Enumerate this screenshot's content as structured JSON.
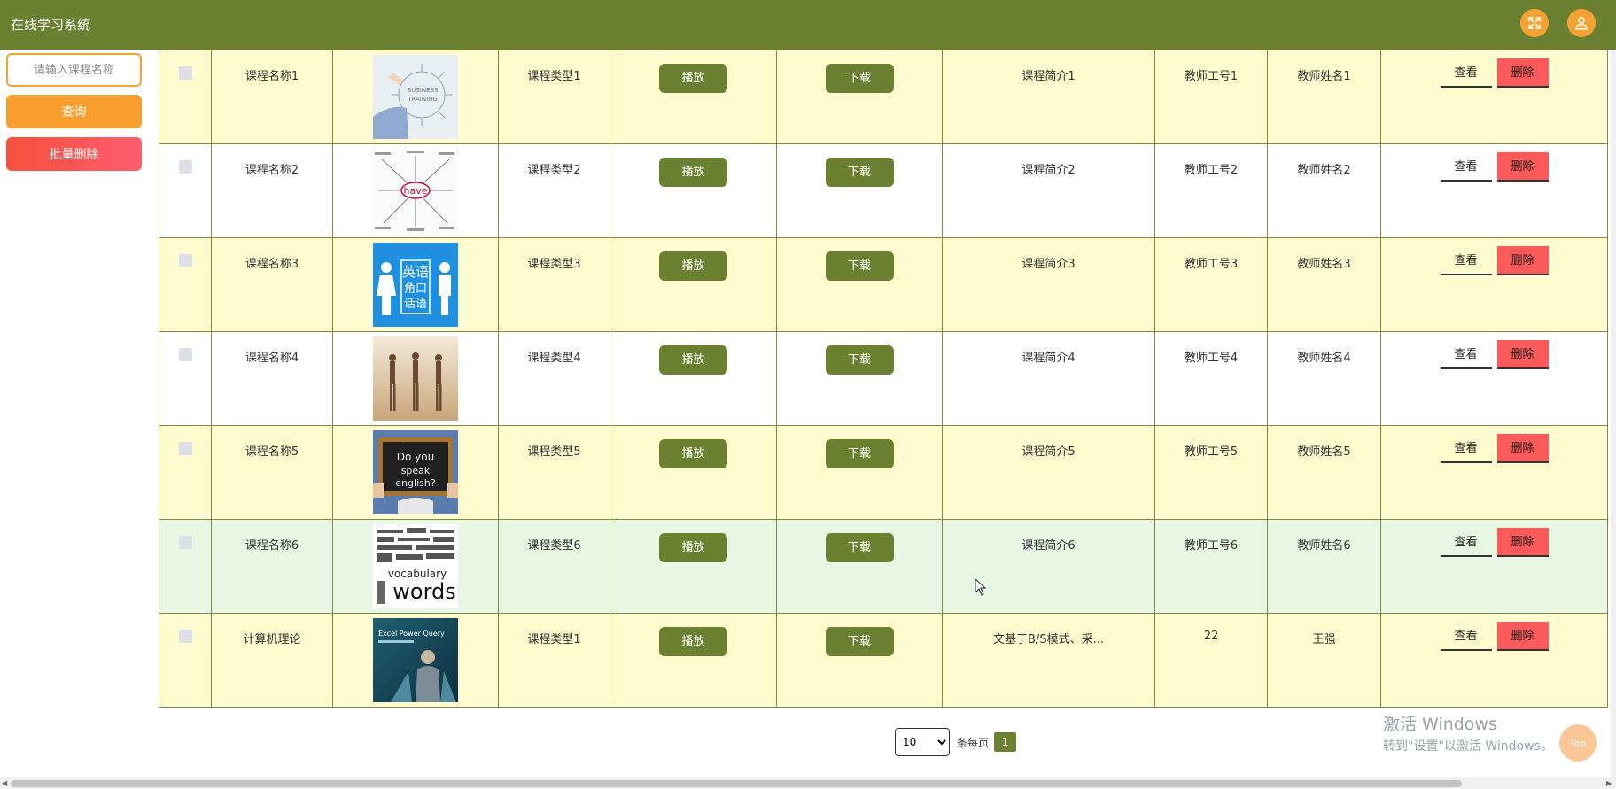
{
  "header": {
    "app_title": "在线学习系统",
    "fullscreen_icon": "fullscreen-icon",
    "user_icon": "user-icon",
    "accent_color": "#6b8030"
  },
  "sidebar": {
    "search_placeholder": "请输入课程名称",
    "query_label": "查询",
    "batch_delete_label": "批量删除"
  },
  "table": {
    "play_label": "播放",
    "download_label": "下载",
    "view_label": "查看",
    "delete_label": "删除",
    "rows": [
      {
        "name": "课程名称1",
        "image": "business-training",
        "type": "课程类型1",
        "intro": "课程简介1",
        "teacher_id": "教师工号1",
        "teacher_name": "教师姓名1"
      },
      {
        "name": "课程名称2",
        "image": "have-word-map",
        "type": "课程类型2",
        "intro": "课程简介2",
        "teacher_id": "教师工号2",
        "teacher_name": "教师姓名2"
      },
      {
        "name": "课程名称3",
        "image": "english-corner-sign",
        "type": "课程类型3",
        "intro": "课程简介3",
        "teacher_id": "教师工号3",
        "teacher_name": "教师姓名3"
      },
      {
        "name": "课程名称4",
        "image": "dancers",
        "type": "课程类型4",
        "intro": "课程简介4",
        "teacher_id": "教师工号4",
        "teacher_name": "教师姓名4"
      },
      {
        "name": "课程名称5",
        "image": "do-you-speak-english",
        "type": "课程类型5",
        "intro": "课程简介5",
        "teacher_id": "教师工号5",
        "teacher_name": "教师姓名5"
      },
      {
        "name": "课程名称6",
        "image": "vocabulary-words",
        "type": "课程类型6",
        "intro": "课程简介6",
        "teacher_id": "教师工号6",
        "teacher_name": "教师姓名6"
      },
      {
        "name": "计算机理论",
        "image": "excel-power-query",
        "type": "课程类型1",
        "intro": "文基于B/S模式、采...",
        "teacher_id": "22",
        "teacher_name": "王强"
      }
    ]
  },
  "pagination": {
    "page_size": "10",
    "per_page_label": "条每页",
    "current_page": "1"
  },
  "watermark": {
    "title": "激活 Windows",
    "subtitle": "转到\"设置\"以激活 Windows。"
  },
  "back_to_top_label": "Top"
}
